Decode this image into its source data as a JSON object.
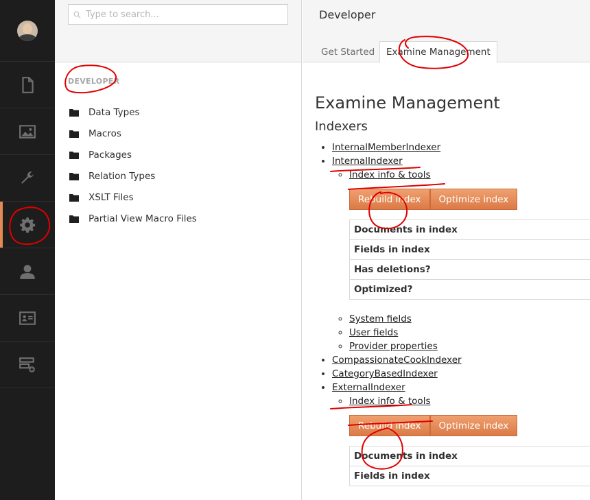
{
  "search": {
    "placeholder": "Type to search..."
  },
  "nav": [
    "content",
    "media",
    "settings",
    "developer",
    "users",
    "members",
    "forms"
  ],
  "tree": {
    "section_title": "DEVELOPER",
    "items": [
      "Data Types",
      "Macros",
      "Packages",
      "Relation Types",
      "XSLT Files",
      "Partial View Macro Files"
    ]
  },
  "header": {
    "title": "Developer",
    "tabs": [
      {
        "label": "Get Started"
      },
      {
        "label": "Examine Management"
      }
    ]
  },
  "main": {
    "heading": "Examine Management",
    "subheading": "Indexers",
    "indexers": [
      "InternalMemberIndexer",
      "InternalIndexer",
      "CompassionateCookIndexer",
      "CategoryBasedIndexer",
      "ExternalIndexer"
    ],
    "index_tools_label": "Index info & tools",
    "rebuild_label": "Rebuild index",
    "optimize_label": "Optimize index",
    "info_rows": [
      "Documents in index",
      "Fields in index",
      "Has deletions?",
      "Optimized?"
    ],
    "sub_links": [
      "System fields",
      "User fields",
      "Provider properties"
    ],
    "info_rows_2": [
      "Documents in index",
      "Fields in index"
    ]
  },
  "colors": {
    "accent": "#e28b54",
    "nav_bg": "#1d1d1d",
    "annotation": "#e00000"
  }
}
